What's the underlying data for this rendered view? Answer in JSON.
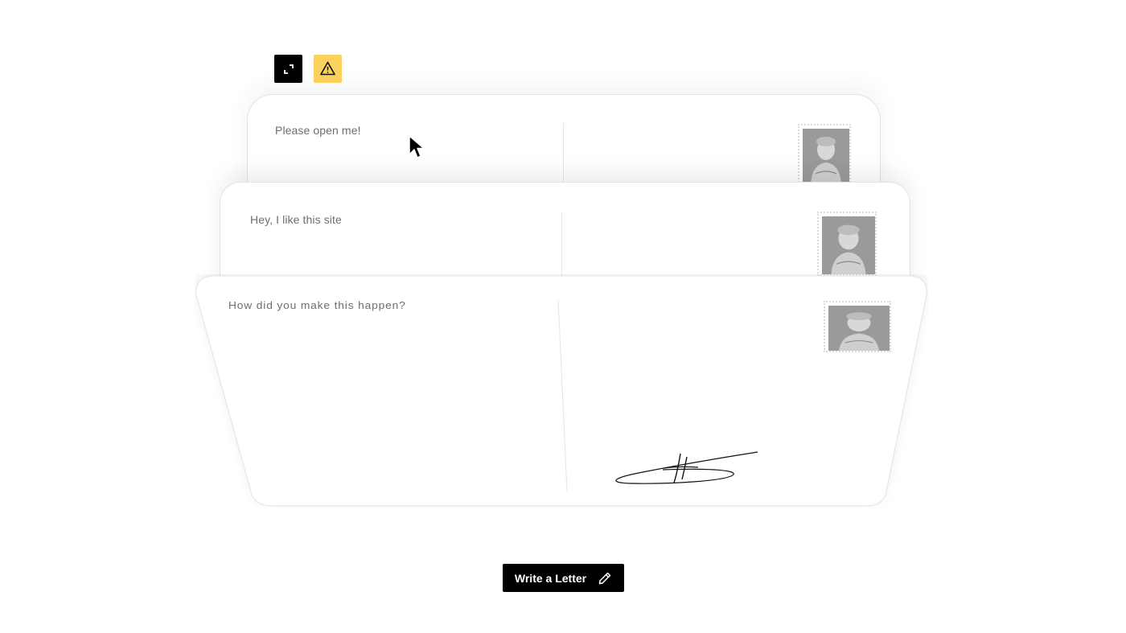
{
  "controls": {
    "expand_icon": "expand-icon",
    "warning_icon": "warning-icon",
    "warning_color": "#fcd25f"
  },
  "postcards": [
    {
      "message": "Please open me!",
      "stamp": "stamp-portrait-icon"
    },
    {
      "message": "Hey, I like this site",
      "stamp": "stamp-portrait-icon"
    },
    {
      "message": "How did you make this happen?",
      "stamp": "stamp-portrait-icon",
      "signature": true
    }
  ],
  "actions": {
    "write_label": "Write a Letter",
    "write_icon": "pencil-icon"
  }
}
